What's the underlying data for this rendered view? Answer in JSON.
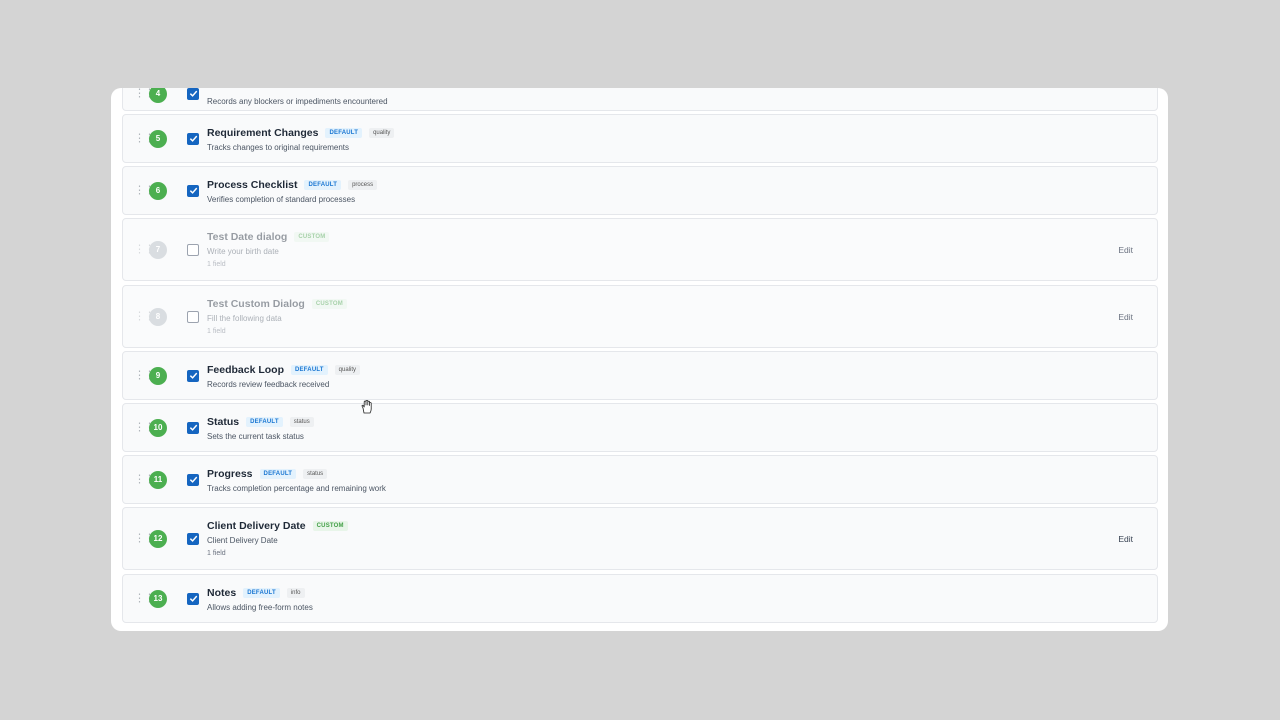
{
  "accent_colors": {
    "step_number": "#4caf50",
    "checkbox": "#1565c0",
    "default_badge": "#1976d2",
    "custom_badge": "#43a047"
  },
  "rows": [
    {
      "number": "4",
      "enabled": true,
      "title": "",
      "badge": "",
      "tag": "",
      "description": "Records any blockers or impediments encountered",
      "fields": "",
      "edit": ""
    },
    {
      "number": "5",
      "enabled": true,
      "title": "Requirement Changes",
      "badge": "DEFAULT",
      "tag": "quality",
      "description": "Tracks changes to original requirements",
      "fields": "",
      "edit": ""
    },
    {
      "number": "6",
      "enabled": true,
      "title": "Process Checklist",
      "badge": "DEFAULT",
      "tag": "process",
      "description": "Verifies completion of standard processes",
      "fields": "",
      "edit": ""
    },
    {
      "number": "7",
      "enabled": false,
      "title": "Test Date dialog",
      "badge": "CUSTOM",
      "tag": "",
      "description": "Write your birth date",
      "fields": "1 field",
      "edit": "Edit"
    },
    {
      "number": "8",
      "enabled": false,
      "title": "Test Custom Dialog",
      "badge": "CUSTOM",
      "tag": "",
      "description": "Fill the following data",
      "fields": "1 field",
      "edit": "Edit"
    },
    {
      "number": "9",
      "enabled": true,
      "title": "Feedback Loop",
      "badge": "DEFAULT",
      "tag": "quality",
      "description": "Records review feedback received",
      "fields": "",
      "edit": ""
    },
    {
      "number": "10",
      "enabled": true,
      "title": "Status",
      "badge": "DEFAULT",
      "tag": "status",
      "description": "Sets the current task status",
      "fields": "",
      "edit": ""
    },
    {
      "number": "11",
      "enabled": true,
      "title": "Progress",
      "badge": "DEFAULT",
      "tag": "status",
      "description": "Tracks completion percentage and remaining work",
      "fields": "",
      "edit": ""
    },
    {
      "number": "12",
      "enabled": true,
      "title": "Client Delivery Date",
      "badge": "CUSTOM",
      "tag": "",
      "description": "Client Delivery Date",
      "fields": "1 field",
      "edit": "Edit"
    },
    {
      "number": "13",
      "enabled": true,
      "title": "Notes",
      "badge": "DEFAULT",
      "tag": "info",
      "description": "Allows adding free-form notes",
      "fields": "",
      "edit": ""
    }
  ]
}
